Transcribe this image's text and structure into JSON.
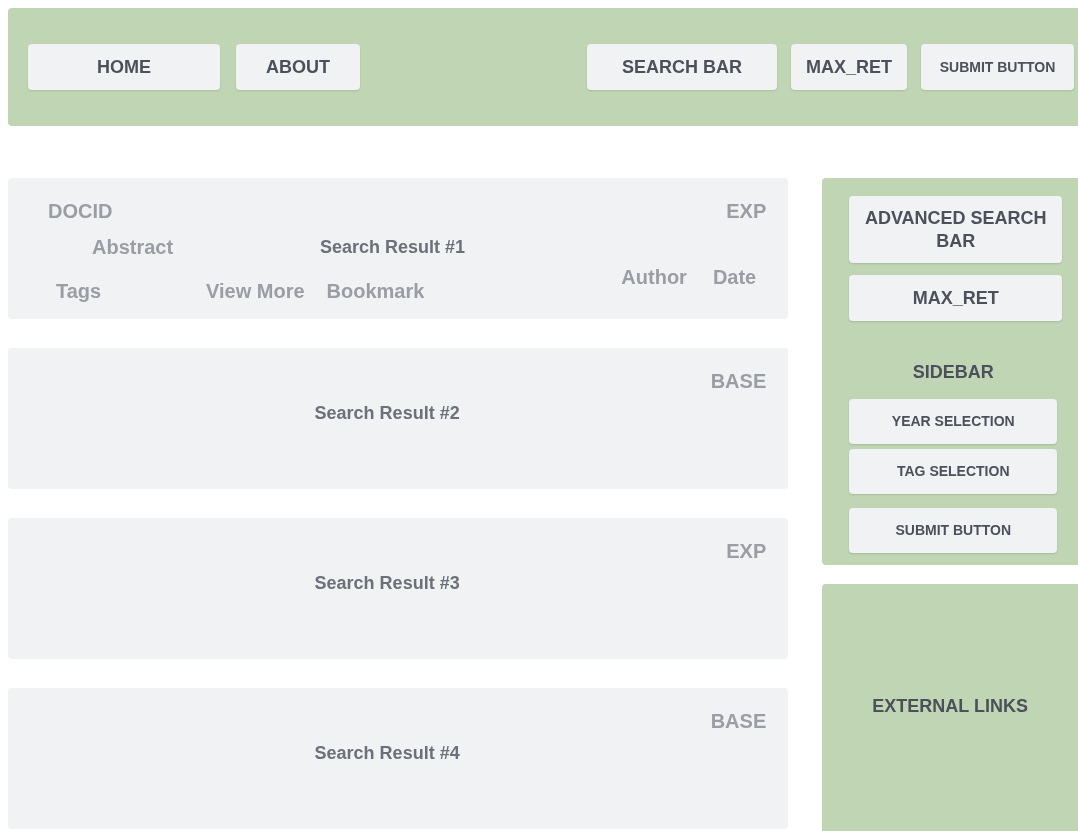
{
  "navbar": {
    "left_buttons": [
      "HOME",
      "ABOUT"
    ],
    "right_buttons": [
      "SEARCH BAR",
      "MAX_RET",
      "SUBMIT BUTTON"
    ]
  },
  "results": [
    {
      "docid": "DOCID",
      "label": "EXP",
      "abstract": "Abstract",
      "title": "Search Result #1",
      "tags": "Tags",
      "view_more": "View More",
      "bookmark": "Bookmark",
      "author": "Author",
      "date": "Date"
    },
    {
      "label": "BASE",
      "title": "Search Result #2"
    },
    {
      "label": "EXP",
      "title": "Search Result #3"
    },
    {
      "label": "BASE",
      "title": "Search Result #4"
    }
  ],
  "sidebar": {
    "advanced_search": "ADVANCED SEARCH BAR",
    "max_ret": "MAX_RET",
    "heading": "SIDEBAR",
    "buttons": [
      "YEAR SELECTION",
      "TAG SELECTION",
      "SUBMIT BUTTON"
    ]
  },
  "external_links": {
    "label": "EXTERNAL LINKS"
  }
}
